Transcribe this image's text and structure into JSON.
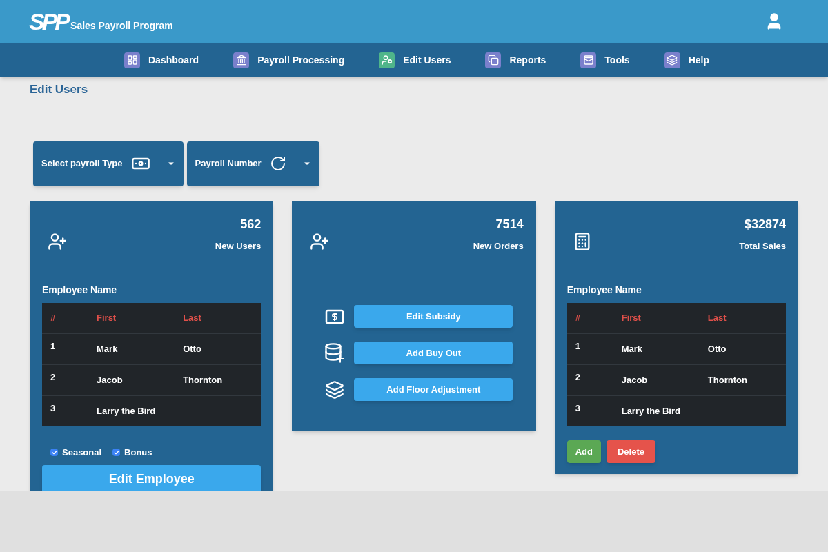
{
  "header": {
    "logo": "SPP",
    "app_name": "Sales Payroll Program"
  },
  "nav": [
    {
      "label": "Dashboard",
      "selected": false
    },
    {
      "label": "Payroll Processing",
      "selected": false
    },
    {
      "label": "Edit Users",
      "selected": true
    },
    {
      "label": "Reports",
      "selected": false
    },
    {
      "label": "Tools",
      "selected": false
    },
    {
      "label": "Help",
      "selected": false
    }
  ],
  "page_title": "Edit Users",
  "dropdowns": [
    {
      "label": "Select payroll Type"
    },
    {
      "label": "Payroll Number"
    }
  ],
  "cards": [
    {
      "kind": "table",
      "value": "562",
      "caption": "New Users",
      "section_title": "Employee Name",
      "table": {
        "columns": [
          "#",
          "First",
          "Last"
        ],
        "rows": [
          [
            "1",
            "Mark",
            "Otto"
          ],
          [
            "2",
            "Jacob",
            "Thornton"
          ],
          [
            "3",
            "Larry the Bird"
          ]
        ]
      },
      "checkboxes": [
        {
          "label": "Seasonal",
          "checked": true
        },
        {
          "label": "Bonus",
          "checked": true
        }
      ],
      "button": "Edit Employee"
    },
    {
      "kind": "actions",
      "value": "7514",
      "caption": "New Orders",
      "actions": [
        {
          "label": "Edit Subsidy"
        },
        {
          "label": "Add Buy Out"
        },
        {
          "label": "Add Floor Adjustment"
        }
      ]
    },
    {
      "kind": "table",
      "value": "$32874",
      "caption": "Total Sales",
      "section_title": "Employee Name",
      "table": {
        "columns": [
          "#",
          "First",
          "Last"
        ],
        "rows": [
          [
            "1",
            "Mark",
            "Otto"
          ],
          [
            "2",
            "Jacob",
            "Thornton"
          ],
          [
            "3",
            "Larry the Bird"
          ]
        ]
      },
      "buttons": [
        {
          "label": "Add",
          "kind": "add"
        },
        {
          "label": "Delete",
          "kind": "delete"
        }
      ]
    }
  ]
}
